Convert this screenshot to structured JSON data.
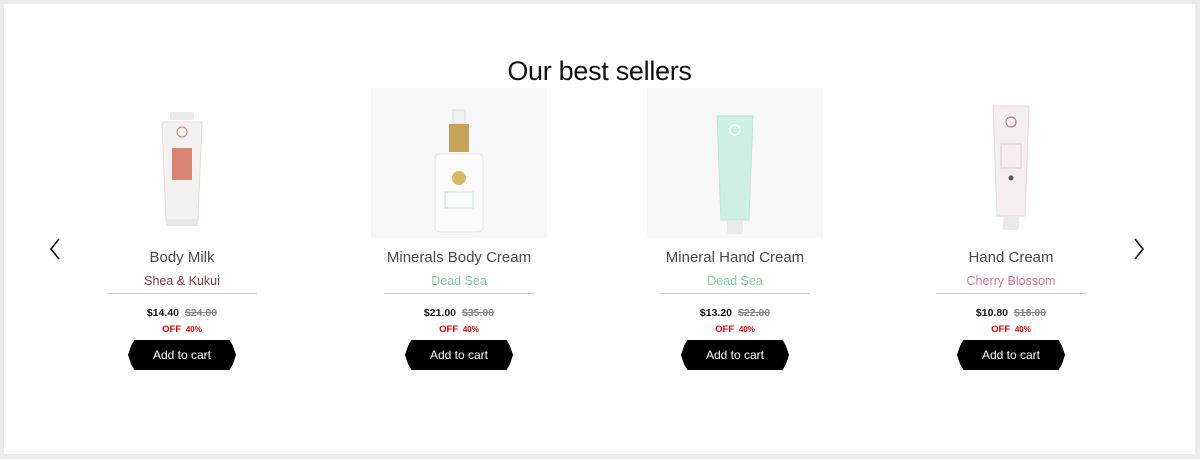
{
  "section": {
    "title": "Our best sellers"
  },
  "carousel": {
    "prev_icon": "chevron-left-icon",
    "next_icon": "chevron-right-icon"
  },
  "products": [
    {
      "name": "Body Milk",
      "variant": "Shea & Kukui",
      "variant_color": "#8a3a3a",
      "price": "$14.40",
      "old_price": "$24.00",
      "off_label": "OFF",
      "off_pct": "40%",
      "cart_label": "Add to cart"
    },
    {
      "name": "Minerals Body Cream",
      "variant": "Dead Sea",
      "variant_color": "#7ccf9a",
      "price": "$21.00",
      "old_price": "$35.00",
      "off_label": "OFF",
      "off_pct": "40%",
      "cart_label": "Add to cart"
    },
    {
      "name": "Mineral Hand Cream",
      "variant": "Dead Sea",
      "variant_color": "#7ccf9a",
      "price": "$13.20",
      "old_price": "$22.00",
      "off_label": "OFF",
      "off_pct": "40%",
      "cart_label": "Add to cart"
    },
    {
      "name": "Hand Cream",
      "variant": "Cherry Blossom",
      "variant_color": "#e0739a",
      "price": "$10.80",
      "old_price": "$18.00",
      "off_label": "OFF",
      "off_pct": "40%",
      "cart_label": "Add to cart"
    }
  ]
}
